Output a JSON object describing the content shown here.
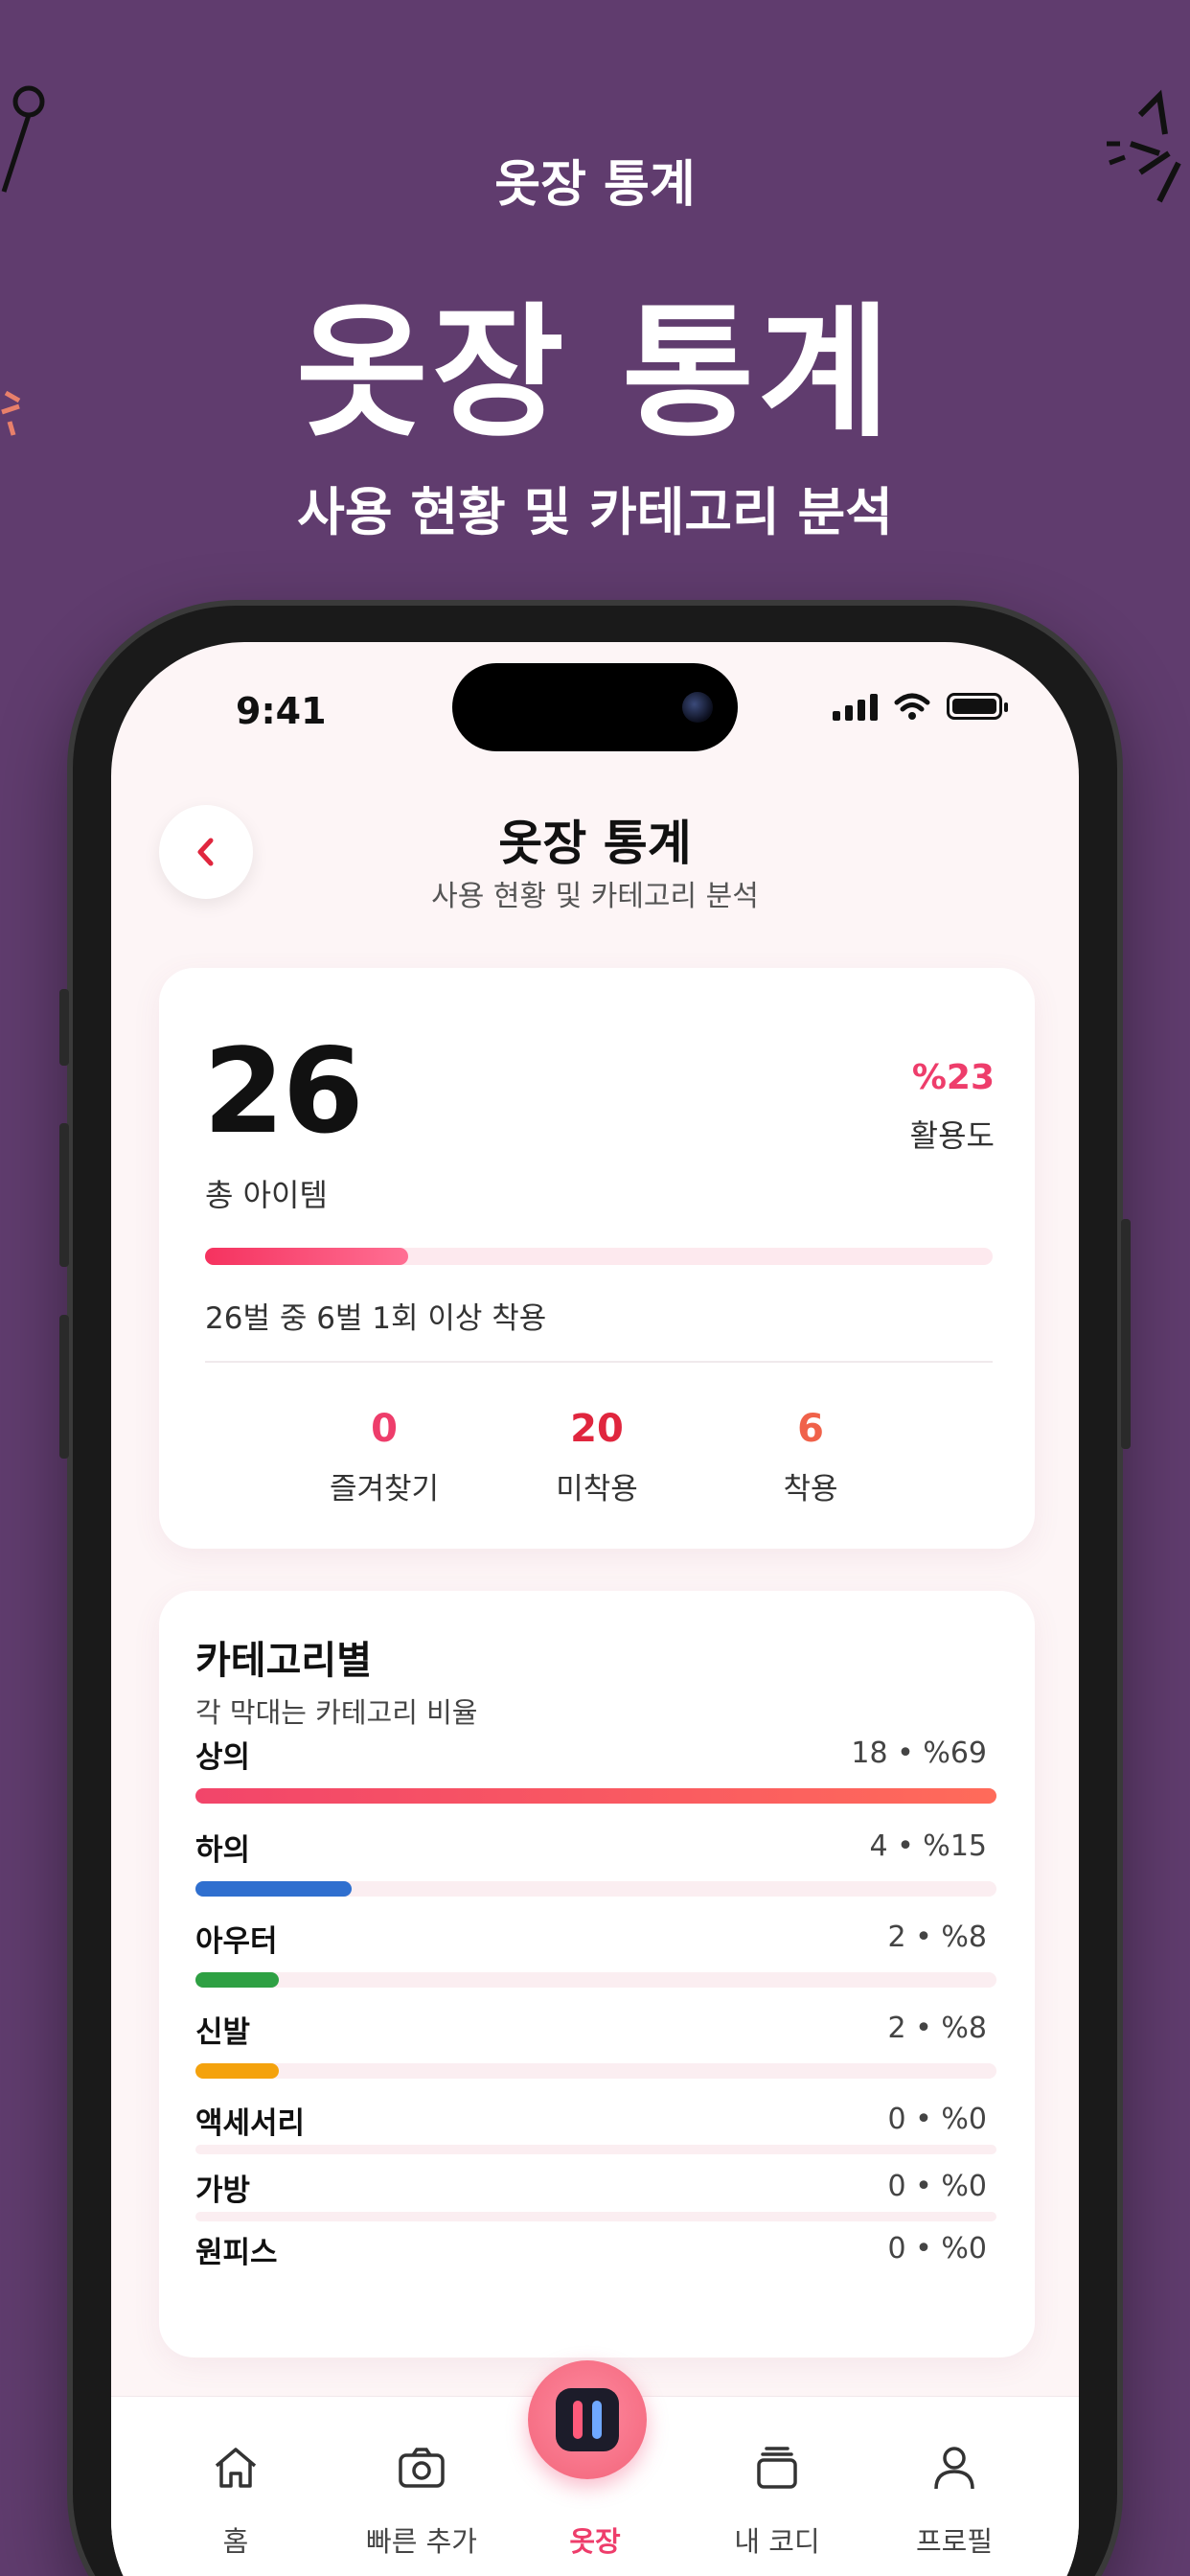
{
  "hero": {
    "eyebrow": "옷장 통계",
    "title": "옷장 통계",
    "subtitle": "사용 현황 및 카테고리 분석"
  },
  "status": {
    "time": "9:41"
  },
  "header": {
    "title": "옷장 통계",
    "subtitle": "사용 현황 및 카테고리 분석",
    "back_icon": "chevron-left-icon"
  },
  "summary": {
    "total": "26",
    "total_label": "총 아이템",
    "utilization_pct": "%23",
    "utilization_value": 0.23,
    "utilization_label": "활용도",
    "caption": "26벌 중 6벌 1회 이상 착용",
    "stats": [
      {
        "value": "0",
        "label": "즐겨찾기",
        "color": "#ee3d6b"
      },
      {
        "value": "20",
        "label": "미착용",
        "color": "#e0263e"
      },
      {
        "value": "6",
        "label": "착용",
        "color": "#f0624a"
      }
    ]
  },
  "categories": {
    "title": "카테고리별",
    "subtitle": "각 막대는 카테고리 비율",
    "items": [
      {
        "name": "상의",
        "meta": "18 • %69",
        "ratio": 0.69,
        "color": "#f2456a"
      },
      {
        "name": "하의",
        "meta": "4 • %15",
        "ratio": 0.15,
        "color": "#2f6fcf"
      },
      {
        "name": "아우터",
        "meta": "2 • %8",
        "ratio": 0.08,
        "color": "#2ea043"
      },
      {
        "name": "신발",
        "meta": "2 • %8",
        "ratio": 0.08,
        "color": "#f4a20d"
      },
      {
        "name": "액세서리",
        "meta": "0 • %0",
        "ratio": 0,
        "color": "#999999"
      },
      {
        "name": "가방",
        "meta": "0 • %0",
        "ratio": 0,
        "color": "#999999"
      },
      {
        "name": "원피스",
        "meta": "0 • %0",
        "ratio": 0,
        "color": "#999999"
      }
    ]
  },
  "tabbar": {
    "tabs": [
      {
        "label": "홈",
        "icon": "home-icon"
      },
      {
        "label": "빠른 추가",
        "icon": "camera-icon"
      },
      {
        "label": "옷장",
        "icon": "wardrobe-icon",
        "active": true
      },
      {
        "label": "내 코디",
        "icon": "cards-icon"
      },
      {
        "label": "프로필",
        "icon": "person-icon"
      }
    ]
  },
  "colors": {
    "background": "#603c6e",
    "accent": "#ee3d6b"
  }
}
